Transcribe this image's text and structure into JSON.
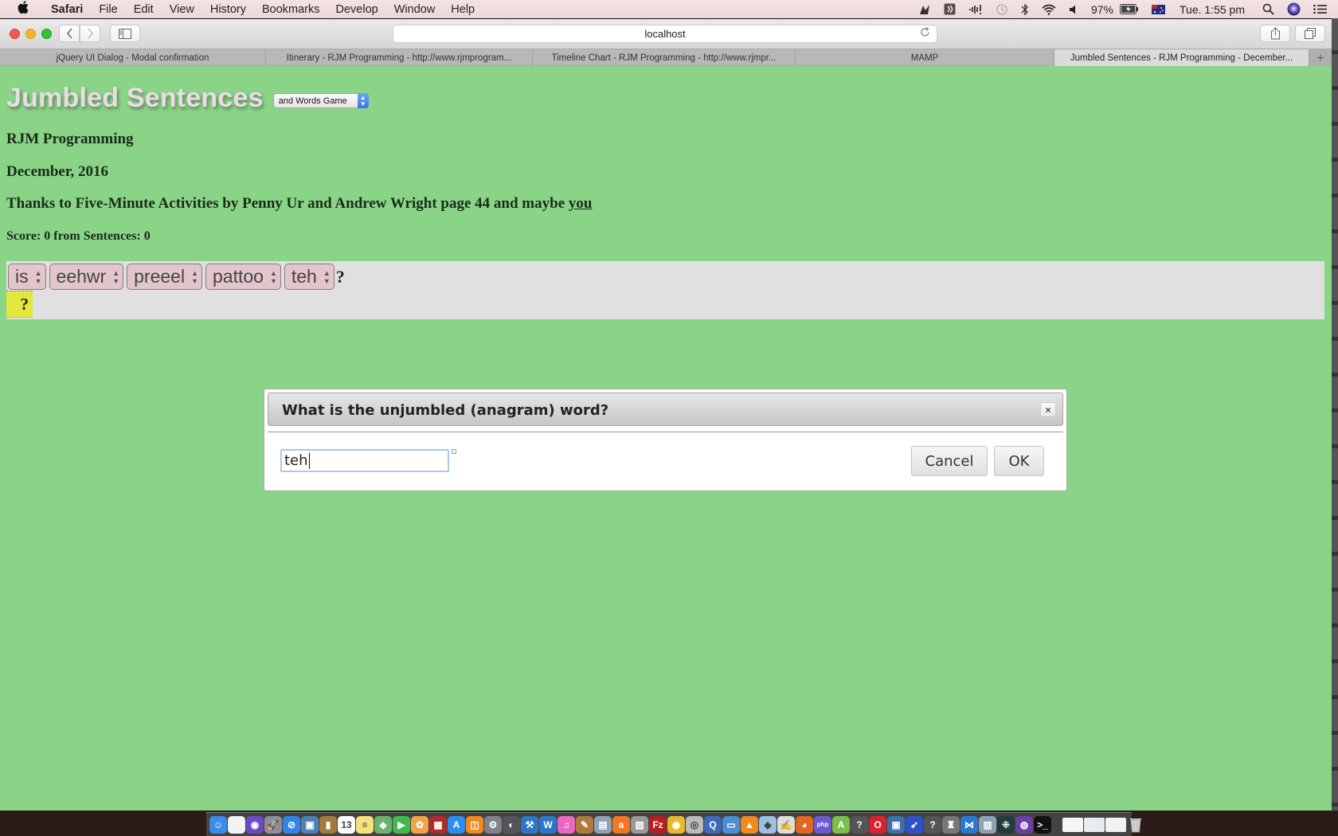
{
  "menubar": {
    "apple_icon": "apple-logo",
    "app_name": "Safari",
    "items": [
      "File",
      "Edit",
      "View",
      "History",
      "Bookmarks",
      "Develop",
      "Window",
      "Help"
    ],
    "status": {
      "battery_percent": "97%",
      "clock": "Tue. 1:55 pm",
      "icons": [
        "app-status-icon",
        "audio-hijack-icon",
        "network-activity-icon",
        "time-machine-icon",
        "bluetooth-icon",
        "wifi-icon",
        "volume-icon",
        "battery-icon",
        "australian-flag-icon",
        "spotlight-icon",
        "siri-icon",
        "notification-center-icon"
      ]
    }
  },
  "browser": {
    "address": "localhost",
    "tabs": [
      {
        "label": "jQuery UI Dialog - Modal confirmation",
        "active": false
      },
      {
        "label": "Itinerary - RJM Programming - http://www.rjmprogram...",
        "active": false
      },
      {
        "label": "Timeline Chart - RJM Programming - http://www.rjmpr...",
        "active": false
      },
      {
        "label": "MAMP",
        "active": false
      },
      {
        "label": "Jumbled Sentences - RJM Programming - December...",
        "active": true
      }
    ],
    "new_tab_label": "+"
  },
  "page": {
    "title": "Jumbled Sentences",
    "game_mode_select": "and Words Game",
    "brand": "RJM Programming",
    "date": "December, 2016",
    "thanks_prefix": "Thanks to Five-Minute Activities by Penny Ur and Andrew Wright page 44 and maybe ",
    "thanks_link": "you",
    "score": "Score: 0 from Sentences: 0",
    "jumbled_words": [
      "is",
      "eehwr",
      "preeel",
      "pattoo",
      "teh"
    ],
    "sentence_end": "?",
    "answer_placeholder": "?"
  },
  "dialog": {
    "title": "What is the unjumbled (anagram) word?",
    "close_label": "×",
    "input_value": "teh",
    "cancel_label": "Cancel",
    "ok_label": "OK"
  },
  "dock": {
    "apps": [
      {
        "name": "finder",
        "color": "#3a8ee6",
        "glyph": "☺"
      },
      {
        "name": "document",
        "color": "#f2f2f2",
        "glyph": ""
      },
      {
        "name": "siri",
        "color": "#6a4bc4",
        "glyph": "◉"
      },
      {
        "name": "launchpad",
        "color": "#8a8f99",
        "glyph": "🚀"
      },
      {
        "name": "safari",
        "color": "#2f86e8",
        "glyph": "⊘"
      },
      {
        "name": "preview",
        "color": "#4f7fb4",
        "glyph": "▣"
      },
      {
        "name": "contacts",
        "color": "#a57a3d",
        "glyph": "▮"
      },
      {
        "name": "calendar",
        "color": "#ffffff",
        "glyph": "13"
      },
      {
        "name": "notes",
        "color": "#f6e27a",
        "glyph": "≡"
      },
      {
        "name": "maps",
        "color": "#6bb36a",
        "glyph": "◈"
      },
      {
        "name": "facetime",
        "color": "#3dbb4e",
        "glyph": "▶"
      },
      {
        "name": "photos",
        "color": "#f1a24b",
        "glyph": "✿"
      },
      {
        "name": "photo-booth",
        "color": "#b42a2a",
        "glyph": "▦"
      },
      {
        "name": "app-store",
        "color": "#2c8ef0",
        "glyph": "A"
      },
      {
        "name": "ibooks",
        "color": "#f08a1c",
        "glyph": "◫"
      },
      {
        "name": "system-preferences",
        "color": "#7d8288",
        "glyph": "⚙"
      },
      {
        "name": "quicktime-spy",
        "color": "#555555",
        "glyph": "◐"
      },
      {
        "name": "xcode",
        "color": "#2c77c9",
        "glyph": "⚒"
      },
      {
        "name": "filezilla-alt",
        "color": "#2c77c9",
        "glyph": "W"
      },
      {
        "name": "itunes",
        "color": "#e868c2",
        "glyph": "♫"
      },
      {
        "name": "script-editor",
        "color": "#b07a3c",
        "glyph": "✎"
      },
      {
        "name": "image-capture",
        "color": "#8fa2b4",
        "glyph": "▤"
      },
      {
        "name": "avast",
        "color": "#f07822",
        "glyph": "a"
      },
      {
        "name": "archive-utility",
        "color": "#999999",
        "glyph": "▧"
      },
      {
        "name": "filezilla",
        "color": "#b81e1e",
        "glyph": "Fz"
      },
      {
        "name": "chrome",
        "color": "#e6ba2c",
        "glyph": "◉"
      },
      {
        "name": "disk-utility",
        "color": "#bbbbbb",
        "glyph": "◎"
      },
      {
        "name": "quicktime",
        "color": "#3d6bb8",
        "glyph": "Q"
      },
      {
        "name": "screen-sharing",
        "color": "#4a8ed6",
        "glyph": "▭"
      },
      {
        "name": "vlc",
        "color": "#f08a1c",
        "glyph": "▲"
      },
      {
        "name": "virtualbox-cube",
        "color": "#9ac0e4",
        "glyph": "◆"
      },
      {
        "name": "textedit",
        "color": "#dddddd",
        "glyph": "✍"
      },
      {
        "name": "firefox",
        "color": "#e2661f",
        "glyph": "◕"
      },
      {
        "name": "phpstorm",
        "color": "#6b5bd0",
        "glyph": "php"
      },
      {
        "name": "android-studio",
        "color": "#7bbf4b",
        "glyph": "A"
      },
      {
        "name": "unknown-app-1",
        "color": "#555555",
        "glyph": "?"
      },
      {
        "name": "opera",
        "color": "#d8222c",
        "glyph": "O"
      },
      {
        "name": "virtualbox",
        "color": "#3e6fa8",
        "glyph": "▣"
      },
      {
        "name": "swift-app",
        "color": "#3050c8",
        "glyph": "➶"
      },
      {
        "name": "unknown-app-2",
        "color": "#555555",
        "glyph": "?"
      },
      {
        "name": "automator",
        "color": "#777777",
        "glyph": "♜"
      },
      {
        "name": "visual-studio-code",
        "color": "#2a78d0",
        "glyph": "⋈"
      },
      {
        "name": "image-viewer",
        "color": "#8fa2b4",
        "glyph": "▥"
      },
      {
        "name": "dotgrid",
        "color": "#1e3c3c",
        "glyph": "⁜"
      },
      {
        "name": "github-desktop",
        "color": "#6a3fa8",
        "glyph": "◍"
      },
      {
        "name": "terminal",
        "color": "#111111",
        "glyph": ">_"
      }
    ],
    "docs": [
      {
        "name": "dock-document-1",
        "color": "#f6f6f6"
      },
      {
        "name": "dock-document-2",
        "color": "#e8ecf2"
      },
      {
        "name": "dock-document-3",
        "color": "#f2f2f2"
      }
    ],
    "trash_label": "trash"
  }
}
